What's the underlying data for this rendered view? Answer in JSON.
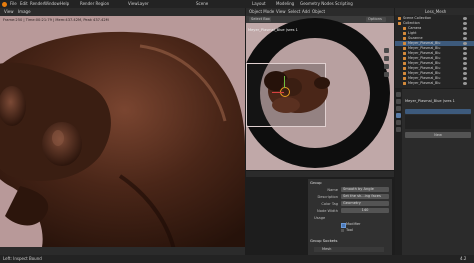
{
  "top_menu": {
    "items": [
      "File",
      "Edit",
      "Render",
      "Window",
      "Help"
    ],
    "workspace_tabs_left": [
      "Layout"
    ],
    "render_region": "Render Region",
    "viewlayer": "ViewLayer",
    "scene": "Scene",
    "workspace_tabs_right": [
      "Modeling",
      "Geometry Nodes",
      "Scripting"
    ]
  },
  "render_window": {
    "header_items": [
      "View",
      "Image"
    ],
    "status": "Frame:250 | Time:00:21:79 | Mem:437.42M, Peak 437.42M"
  },
  "viewport": {
    "header_items": [
      "View",
      "Select",
      "Add",
      "Object"
    ],
    "mode": "Object Mode",
    "sub_header_button": "Select Box",
    "options": "Options",
    "object_label": "Meyer_Plasmal_Blue (sres 1"
  },
  "outliner": {
    "rows": [
      "Scene Collection",
      "Collection",
      "Camera",
      "Light",
      "Suzanne",
      "Meyer_Plasmal_Blu",
      "Meyer_Plasmal_Blu",
      "Meyer_Plasmal_Blu",
      "Meyer_Plasmal_Blu",
      "Meyer_Plasmal_Blu",
      "Meyer_Plasmal_Blu",
      "Meyer_Plasmal_Blu",
      "Meyer_Plasmal_Blu",
      "Meyer_Plasmal_Blu"
    ],
    "search_label": "Less_Mesh"
  },
  "properties": {
    "title": "Meyer_Plasmal_Blue (sres 1",
    "new_button": "New"
  },
  "modifier_panel": {
    "header": "Group",
    "fields": [
      {
        "label": "Name",
        "value": "Smooth by Angle"
      },
      {
        "label": "Description",
        "value": "Set the sh...ing faces"
      },
      {
        "label": "Color Tag",
        "value": "Geometry"
      },
      {
        "label": "Node Width",
        "value": "140"
      }
    ],
    "usage_label": "Usage",
    "checkbox_modifier": "Modifier",
    "checkbox_tool": "Tool",
    "sockets_header": "Group Sockets",
    "socket_item": "Mesh"
  },
  "status_bar": {
    "left": "Left: Inspect Bound",
    "right": "4.2"
  },
  "colors": {
    "accent": "#3d5a7c",
    "background_pink": "#b89999",
    "wood_dark": "#3a1e12",
    "ring_dark": "#0e0e0e",
    "editor_bg": "#1d1d1d"
  }
}
